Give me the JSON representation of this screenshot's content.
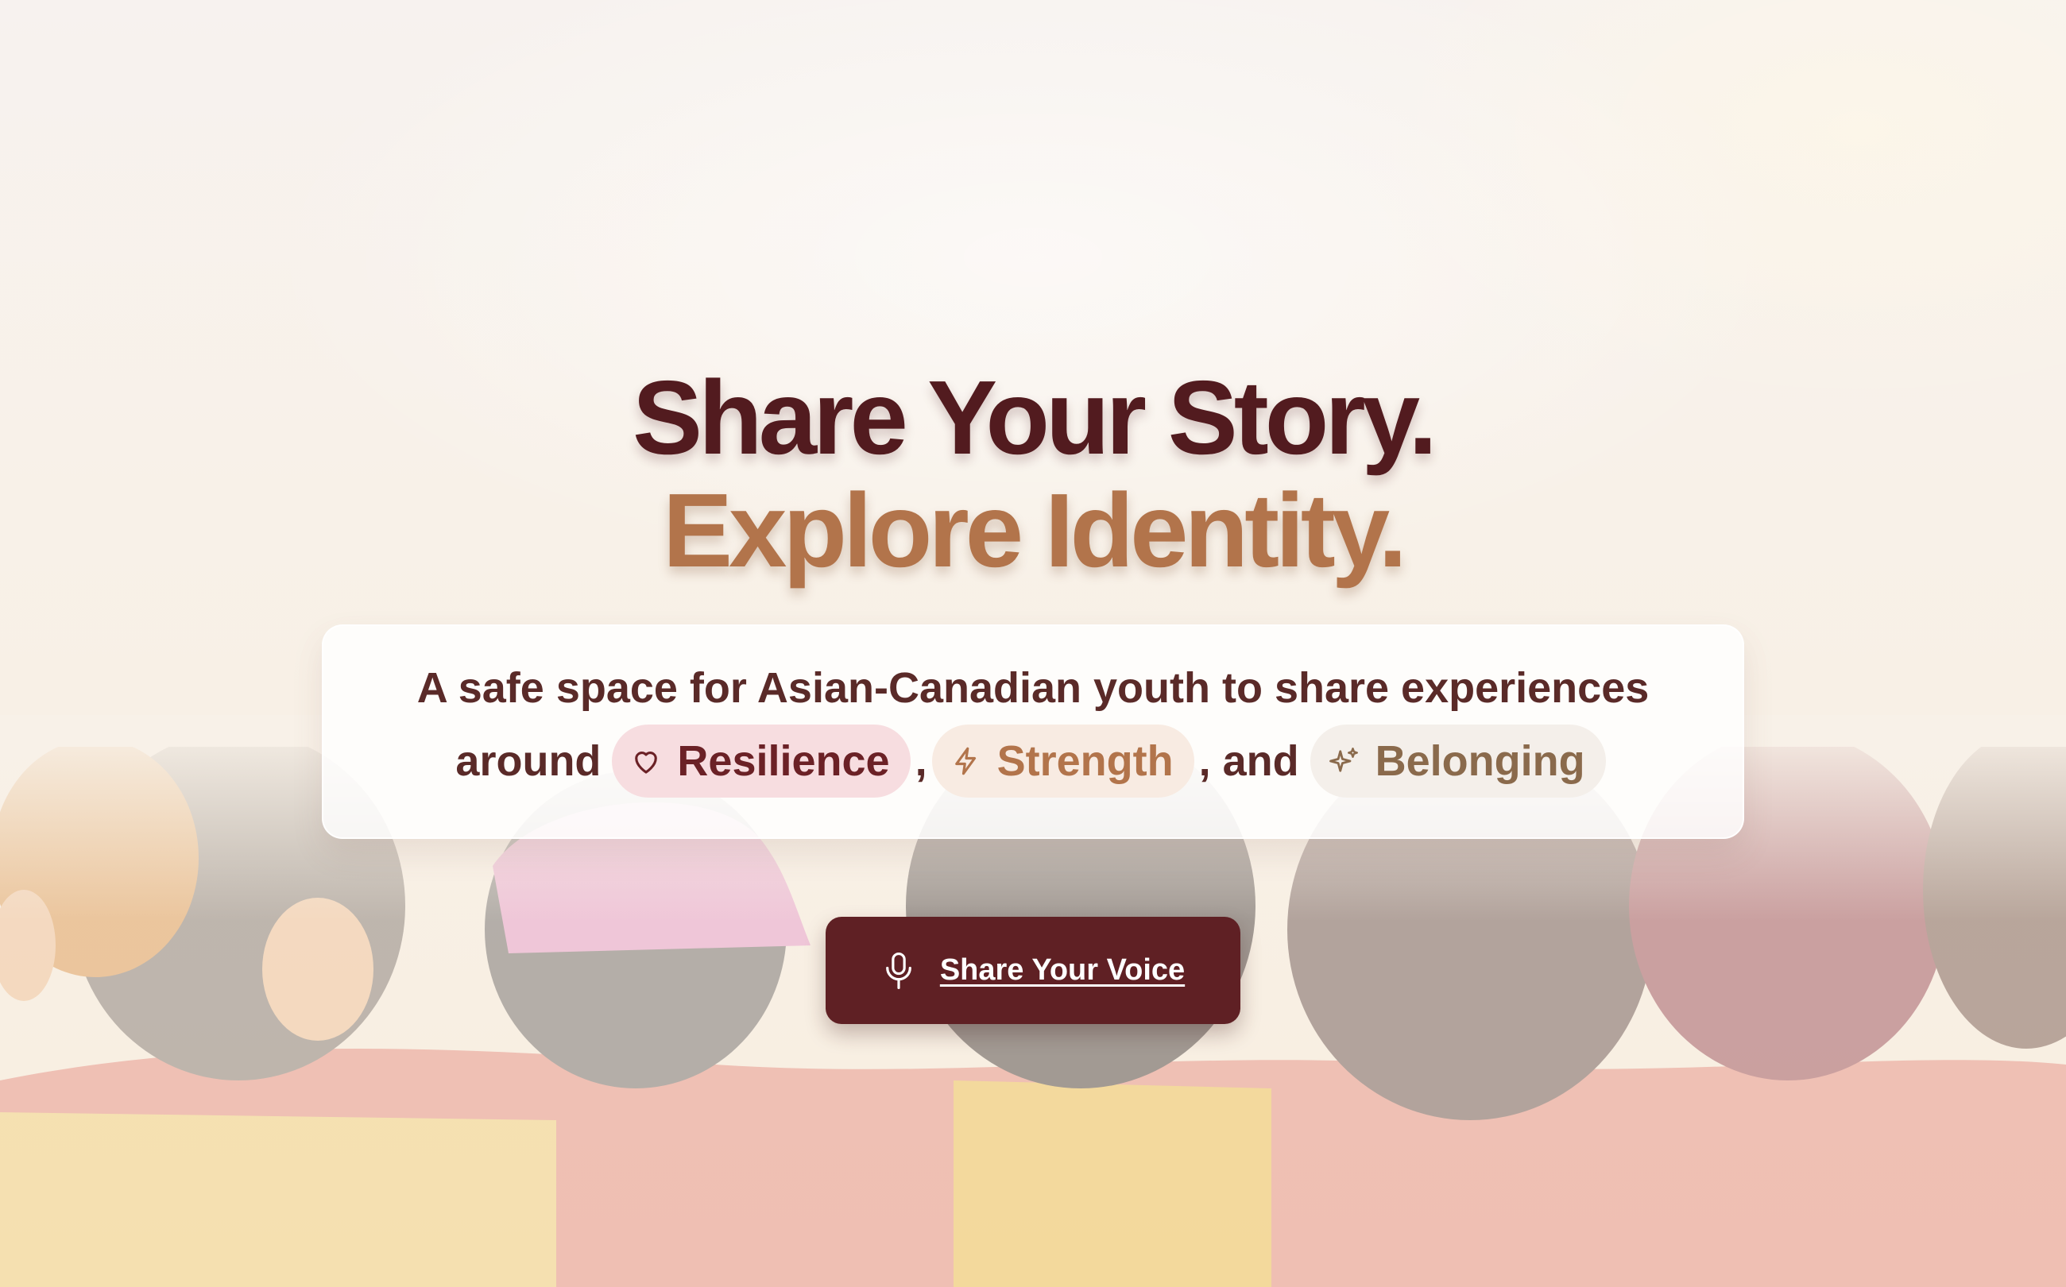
{
  "hero": {
    "headline_line_1": "Share Your Story.",
    "headline_line_2": "Explore Identity."
  },
  "tagline": {
    "line_1": "A safe space for Asian-Canadian youth to share experiences",
    "around": "around",
    "comma": ",",
    "and": ", and",
    "pills": [
      {
        "label": "Resilience",
        "icon": "heart-icon"
      },
      {
        "label": "Strength",
        "icon": "lightning-icon"
      },
      {
        "label": "Belonging",
        "icon": "sparkles-icon"
      }
    ]
  },
  "cta": {
    "label": "Share Your Voice",
    "icon": "microphone-icon"
  },
  "colors": {
    "headline_primary": "#521b1f",
    "headline_accent": "#b2744b",
    "button_bg": "#5f2024",
    "pill_resilience_bg": "#f7dde0",
    "pill_strength_bg": "#f8ebe2",
    "pill_belonging_bg": "#f4efea"
  }
}
